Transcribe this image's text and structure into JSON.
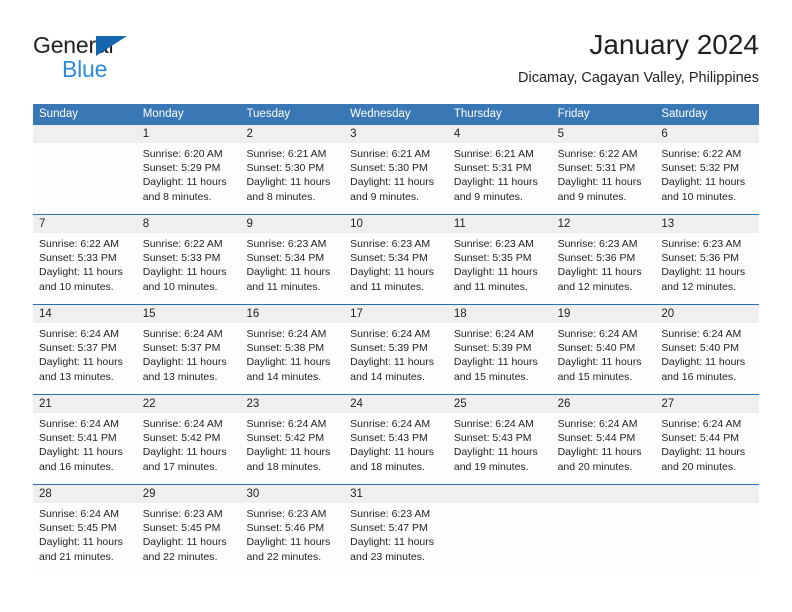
{
  "brand": {
    "name_part1": "General",
    "name_part2": "Blue",
    "triangle_icon": "brand-triangle-icon",
    "colors": {
      "black": "#231f20",
      "blue": "#2e8ad6",
      "triangle": "#1565b0"
    }
  },
  "header": {
    "title": "January 2024",
    "subtitle": "Dicamay, Cagayan Valley, Philippines"
  },
  "theme": {
    "header_blue": "#3a78b5",
    "row_divider_blue": "#2c6fb0",
    "daynum_band": "#efefef",
    "cell_background": "#fdfdfd",
    "text": "#231f20"
  },
  "calendar": {
    "weekdays": [
      "Sunday",
      "Monday",
      "Tuesday",
      "Wednesday",
      "Thursday",
      "Friday",
      "Saturday"
    ],
    "weeks": [
      [
        {
          "day": "",
          "lines": []
        },
        {
          "day": "1",
          "lines": [
            "Sunrise: 6:20 AM",
            "Sunset: 5:29 PM",
            "Daylight: 11 hours",
            "and 8 minutes."
          ]
        },
        {
          "day": "2",
          "lines": [
            "Sunrise: 6:21 AM",
            "Sunset: 5:30 PM",
            "Daylight: 11 hours",
            "and 8 minutes."
          ]
        },
        {
          "day": "3",
          "lines": [
            "Sunrise: 6:21 AM",
            "Sunset: 5:30 PM",
            "Daylight: 11 hours",
            "and 9 minutes."
          ]
        },
        {
          "day": "4",
          "lines": [
            "Sunrise: 6:21 AM",
            "Sunset: 5:31 PM",
            "Daylight: 11 hours",
            "and 9 minutes."
          ]
        },
        {
          "day": "5",
          "lines": [
            "Sunrise: 6:22 AM",
            "Sunset: 5:31 PM",
            "Daylight: 11 hours",
            "and 9 minutes."
          ]
        },
        {
          "day": "6",
          "lines": [
            "Sunrise: 6:22 AM",
            "Sunset: 5:32 PM",
            "Daylight: 11 hours",
            "and 10 minutes."
          ]
        }
      ],
      [
        {
          "day": "7",
          "lines": [
            "Sunrise: 6:22 AM",
            "Sunset: 5:33 PM",
            "Daylight: 11 hours",
            "and 10 minutes."
          ]
        },
        {
          "day": "8",
          "lines": [
            "Sunrise: 6:22 AM",
            "Sunset: 5:33 PM",
            "Daylight: 11 hours",
            "and 10 minutes."
          ]
        },
        {
          "day": "9",
          "lines": [
            "Sunrise: 6:23 AM",
            "Sunset: 5:34 PM",
            "Daylight: 11 hours",
            "and 11 minutes."
          ]
        },
        {
          "day": "10",
          "lines": [
            "Sunrise: 6:23 AM",
            "Sunset: 5:34 PM",
            "Daylight: 11 hours",
            "and 11 minutes."
          ]
        },
        {
          "day": "11",
          "lines": [
            "Sunrise: 6:23 AM",
            "Sunset: 5:35 PM",
            "Daylight: 11 hours",
            "and 11 minutes."
          ]
        },
        {
          "day": "12",
          "lines": [
            "Sunrise: 6:23 AM",
            "Sunset: 5:36 PM",
            "Daylight: 11 hours",
            "and 12 minutes."
          ]
        },
        {
          "day": "13",
          "lines": [
            "Sunrise: 6:23 AM",
            "Sunset: 5:36 PM",
            "Daylight: 11 hours",
            "and 12 minutes."
          ]
        }
      ],
      [
        {
          "day": "14",
          "lines": [
            "Sunrise: 6:24 AM",
            "Sunset: 5:37 PM",
            "Daylight: 11 hours",
            "and 13 minutes."
          ]
        },
        {
          "day": "15",
          "lines": [
            "Sunrise: 6:24 AM",
            "Sunset: 5:37 PM",
            "Daylight: 11 hours",
            "and 13 minutes."
          ]
        },
        {
          "day": "16",
          "lines": [
            "Sunrise: 6:24 AM",
            "Sunset: 5:38 PM",
            "Daylight: 11 hours",
            "and 14 minutes."
          ]
        },
        {
          "day": "17",
          "lines": [
            "Sunrise: 6:24 AM",
            "Sunset: 5:39 PM",
            "Daylight: 11 hours",
            "and 14 minutes."
          ]
        },
        {
          "day": "18",
          "lines": [
            "Sunrise: 6:24 AM",
            "Sunset: 5:39 PM",
            "Daylight: 11 hours",
            "and 15 minutes."
          ]
        },
        {
          "day": "19",
          "lines": [
            "Sunrise: 6:24 AM",
            "Sunset: 5:40 PM",
            "Daylight: 11 hours",
            "and 15 minutes."
          ]
        },
        {
          "day": "20",
          "lines": [
            "Sunrise: 6:24 AM",
            "Sunset: 5:40 PM",
            "Daylight: 11 hours",
            "and 16 minutes."
          ]
        }
      ],
      [
        {
          "day": "21",
          "lines": [
            "Sunrise: 6:24 AM",
            "Sunset: 5:41 PM",
            "Daylight: 11 hours",
            "and 16 minutes."
          ]
        },
        {
          "day": "22",
          "lines": [
            "Sunrise: 6:24 AM",
            "Sunset: 5:42 PM",
            "Daylight: 11 hours",
            "and 17 minutes."
          ]
        },
        {
          "day": "23",
          "lines": [
            "Sunrise: 6:24 AM",
            "Sunset: 5:42 PM",
            "Daylight: 11 hours",
            "and 18 minutes."
          ]
        },
        {
          "day": "24",
          "lines": [
            "Sunrise: 6:24 AM",
            "Sunset: 5:43 PM",
            "Daylight: 11 hours",
            "and 18 minutes."
          ]
        },
        {
          "day": "25",
          "lines": [
            "Sunrise: 6:24 AM",
            "Sunset: 5:43 PM",
            "Daylight: 11 hours",
            "and 19 minutes."
          ]
        },
        {
          "day": "26",
          "lines": [
            "Sunrise: 6:24 AM",
            "Sunset: 5:44 PM",
            "Daylight: 11 hours",
            "and 20 minutes."
          ]
        },
        {
          "day": "27",
          "lines": [
            "Sunrise: 6:24 AM",
            "Sunset: 5:44 PM",
            "Daylight: 11 hours",
            "and 20 minutes."
          ]
        }
      ],
      [
        {
          "day": "28",
          "lines": [
            "Sunrise: 6:24 AM",
            "Sunset: 5:45 PM",
            "Daylight: 11 hours",
            "and 21 minutes."
          ]
        },
        {
          "day": "29",
          "lines": [
            "Sunrise: 6:23 AM",
            "Sunset: 5:45 PM",
            "Daylight: 11 hours",
            "and 22 minutes."
          ]
        },
        {
          "day": "30",
          "lines": [
            "Sunrise: 6:23 AM",
            "Sunset: 5:46 PM",
            "Daylight: 11 hours",
            "and 22 minutes."
          ]
        },
        {
          "day": "31",
          "lines": [
            "Sunrise: 6:23 AM",
            "Sunset: 5:47 PM",
            "Daylight: 11 hours",
            "and 23 minutes."
          ]
        },
        {
          "day": "",
          "lines": []
        },
        {
          "day": "",
          "lines": []
        },
        {
          "day": "",
          "lines": []
        }
      ]
    ]
  }
}
